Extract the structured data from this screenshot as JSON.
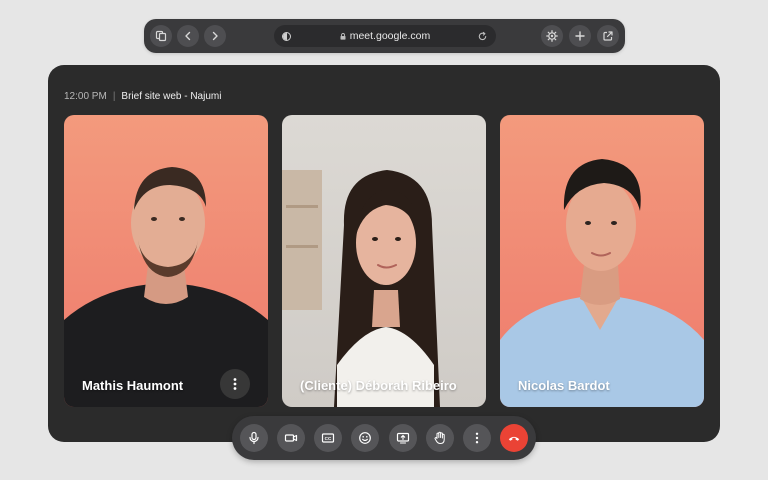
{
  "browser": {
    "url": "meet.google.com"
  },
  "meeting": {
    "time": "12:00 PM",
    "separator": "|",
    "title": "Brief site web - Najumi"
  },
  "participants": [
    {
      "name": "Mathis Haumont"
    },
    {
      "name": "(Cliente) Déborah Ribeiro"
    },
    {
      "name": "Nicolas Bardot"
    }
  ],
  "colors": {
    "end_call": "#ea4335",
    "tile_bg": "#f39a7d",
    "window_bg": "#2b2b2b"
  },
  "icons": {
    "toolbar_left": [
      "tab-overview-icon",
      "back-icon",
      "forward-icon"
    ],
    "toolbar_right": [
      "settings-icon",
      "new-tab-icon",
      "share-icon"
    ],
    "controls": [
      "microphone-icon",
      "camera-icon",
      "captions-icon",
      "emoji-icon",
      "present-screen-icon",
      "raise-hand-icon",
      "more-options-icon",
      "end-call-icon"
    ]
  }
}
